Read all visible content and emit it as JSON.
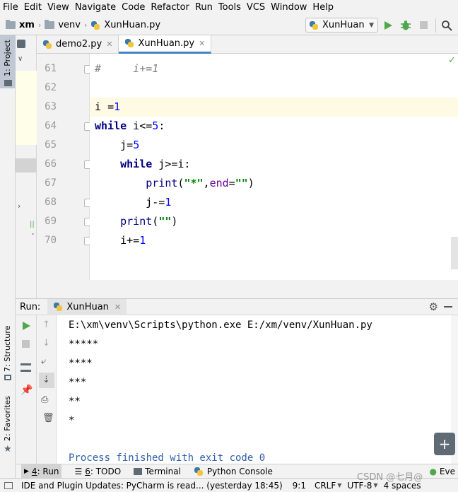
{
  "menu": [
    "File",
    "Edit",
    "View",
    "Navigate",
    "Code",
    "Refactor",
    "Run",
    "Tools",
    "VCS",
    "Window",
    "Help"
  ],
  "nav": {
    "project": "xm",
    "folder": "venv",
    "file": "XunHuan.py"
  },
  "run_config": "XunHuan",
  "left_tools": {
    "project": "1: Project",
    "structure": "7: Structure",
    "favorites": "2: Favorites"
  },
  "tabs": [
    {
      "label": "demo2.py",
      "active": false
    },
    {
      "label": "XunHuan.py",
      "active": true
    }
  ],
  "editor": {
    "line_numbers": [
      "61",
      "62",
      "63",
      "64",
      "65",
      "66",
      "67",
      "68",
      "69",
      "70"
    ],
    "lines": {
      "l61": "#     i+=1",
      "l63a": "i ",
      "l63b": "=",
      "l63c": "1",
      "l64kw": "while",
      "l64a": " i<=",
      "l64n": "5",
      "l64b": ":",
      "l65a": "    j=",
      "l65n": "5",
      "l66kw": "    while",
      "l66a": " j>=i:",
      "l67a": "        print",
      "l67p": "(",
      "l67s1": "\"*\"",
      "l67c": ",",
      "l67e": "end",
      "l67eq": "=",
      "l67s2": "\"\"",
      "l67p2": ")",
      "l68a": "        j-=",
      "l68n": "1",
      "l69a": "    print",
      "l69p": "(",
      "l69s": "\"\"",
      "l69p2": ")",
      "l70a": "    i+=",
      "l70n": "1"
    }
  },
  "run": {
    "label": "Run:",
    "tab": "XunHuan",
    "output": [
      "E:\\xm\\venv\\Scripts\\python.exe E:/xm/venv/XunHuan.py",
      "*****",
      "****",
      "***",
      "**",
      "*",
      "",
      "Process finished with exit code 0"
    ]
  },
  "bottom_tools": [
    {
      "num": "4",
      "label": ": Run"
    },
    {
      "num": "6",
      "label": ": TODO"
    },
    {
      "num": "",
      "label": "Terminal"
    },
    {
      "num": "",
      "label": "Python Console"
    }
  ],
  "event_log": "Eve",
  "status": {
    "message": "IDE and Plugin Updates: PyCharm is read... (yesterday 18:45)",
    "position": "9:1",
    "line_sep": "CRLF",
    "encoding": "UTF-8",
    "indent": "4 spaces"
  },
  "watermark": "CSDN @七月@",
  "colors": {
    "accent": "#4083c9",
    "keyword": "#000080",
    "string": "#008000",
    "number": "#0000ff",
    "run_green": "#4fa84b"
  }
}
